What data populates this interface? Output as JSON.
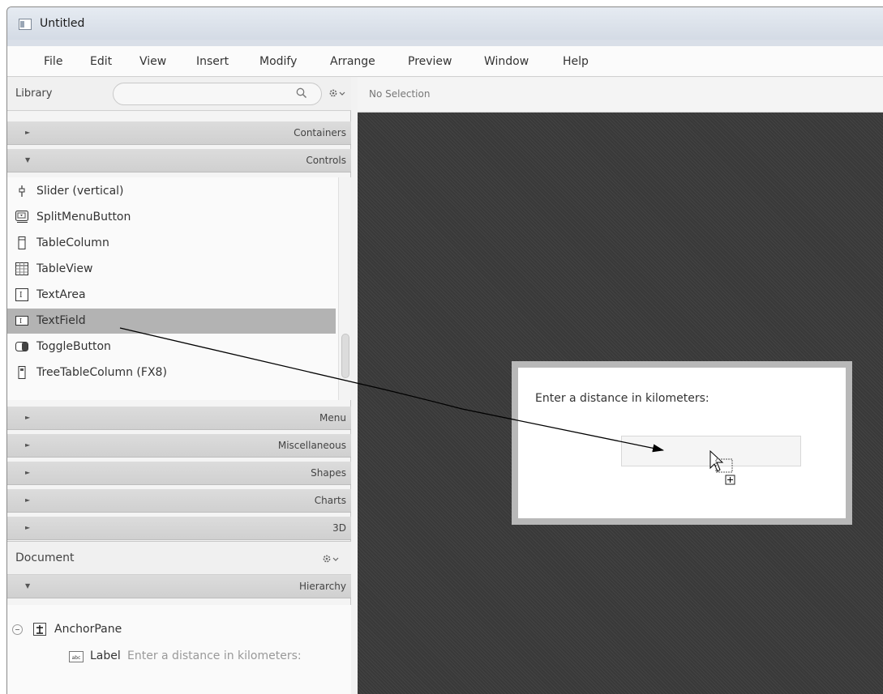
{
  "window": {
    "title": "Untitled"
  },
  "menubar": {
    "items": [
      "File",
      "Edit",
      "View",
      "Insert",
      "Modify",
      "Arrange",
      "Preview",
      "Window",
      "Help"
    ]
  },
  "library": {
    "title": "Library",
    "search_placeholder": "",
    "sections_top": [
      {
        "label": "Containers",
        "expanded": false,
        "arrow": "►"
      },
      {
        "label": "Controls",
        "expanded": true,
        "arrow": "▼"
      }
    ],
    "controls_items": [
      {
        "label": "Slider  (vertical)",
        "icon": "slider-vertical-icon"
      },
      {
        "label": "SplitMenuButton",
        "icon": "split-menu-button-icon"
      },
      {
        "label": "TableColumn",
        "icon": "table-column-icon"
      },
      {
        "label": "TableView",
        "icon": "table-view-icon"
      },
      {
        "label": "TextArea",
        "icon": "text-area-icon"
      },
      {
        "label": "TextField",
        "icon": "text-field-icon",
        "selected": true
      },
      {
        "label": "ToggleButton",
        "icon": "toggle-button-icon"
      },
      {
        "label": "TreeTableColumn  (FX8)",
        "icon": "tree-table-column-icon"
      }
    ],
    "sections_bottom": [
      {
        "label": "Menu",
        "arrow": "►"
      },
      {
        "label": "Miscellaneous",
        "arrow": "►"
      },
      {
        "label": "Shapes",
        "arrow": "►"
      },
      {
        "label": "Charts",
        "arrow": "►"
      },
      {
        "label": "3D",
        "arrow": "►"
      }
    ]
  },
  "document": {
    "title": "Document",
    "hierarchy_section": {
      "label": "Hierarchy",
      "arrow": "▼"
    },
    "tree": {
      "root": {
        "label": "AnchorPane"
      },
      "child": {
        "type": "Label",
        "text": "Enter a distance in kilometers:"
      }
    }
  },
  "canvas": {
    "selection_text": "No Selection",
    "pane_label": "Enter a distance in kilometers:"
  },
  "colors": {
    "canvas_bg": "#393939",
    "selected_row": "#b3b3b3",
    "pane_border": "#b8b8b8"
  }
}
